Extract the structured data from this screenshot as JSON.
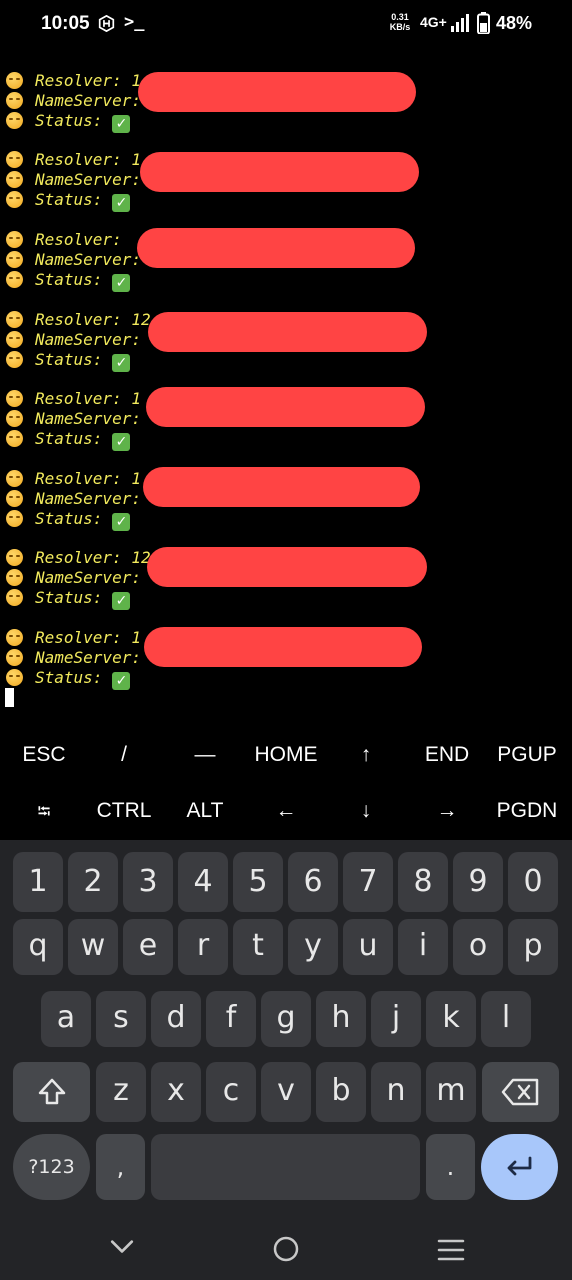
{
  "status_bar": {
    "time": "10:05",
    "speed_value": "0.31",
    "speed_unit": "KB/s",
    "network": "4G+",
    "battery_pct": "48%",
    "icons": [
      "hex-icon",
      "terminal-prompt-icon",
      "signal-icon",
      "battery-icon"
    ]
  },
  "terminal": {
    "entries": [
      {
        "resolver": "Resolver: 1",
        "nameserver": "NameServer:",
        "status": "Status:"
      },
      {
        "resolver": "Resolver: 1",
        "nameserver": "NameServer:",
        "status": "Status:"
      },
      {
        "resolver": "Resolver: ",
        "nameserver": "NameServer:",
        "status": "Status:"
      },
      {
        "resolver": "Resolver: 12",
        "nameserver": "NameServer:",
        "status": "Status:"
      },
      {
        "resolver": "Resolver: 1",
        "nameserver": "NameServer:",
        "status": "Status:"
      },
      {
        "resolver": "Resolver: 1",
        "nameserver": "NameServer:",
        "status": "Status:"
      },
      {
        "resolver": "Resolver: 12",
        "nameserver": "NameServer:",
        "status": "Status:"
      },
      {
        "resolver": "Resolver: 1",
        "nameserver": "NameServer:",
        "status": "Status:"
      }
    ],
    "status_mark": "✓",
    "text_color": "#f2ea5d",
    "redaction_color": "#ff4444"
  },
  "extra_keys": {
    "row1": [
      "ESC",
      "/",
      "—",
      "HOME",
      "↑",
      "END",
      "PGUP"
    ],
    "row2": [
      "⭾",
      "CTRL",
      "ALT",
      "←",
      "↓",
      "→",
      "PGDN"
    ]
  },
  "keyboard": {
    "numbers": [
      "1",
      "2",
      "3",
      "4",
      "5",
      "6",
      "7",
      "8",
      "9",
      "0"
    ],
    "row_q": [
      "q",
      "w",
      "e",
      "r",
      "t",
      "y",
      "u",
      "i",
      "o",
      "p"
    ],
    "row_a": [
      "a",
      "s",
      "d",
      "f",
      "g",
      "h",
      "j",
      "k",
      "l"
    ],
    "row_z": [
      "z",
      "x",
      "c",
      "v",
      "b",
      "n",
      "m"
    ],
    "symbols_label": "?123",
    "comma": ",",
    "period": ".",
    "icons": [
      "shift-icon",
      "backspace-icon",
      "enter-icon"
    ],
    "enter_color": "#a8c7fa"
  },
  "nav_bar": {
    "icons": [
      "back-chevron-icon",
      "home-circle-icon",
      "recents-menu-icon"
    ]
  }
}
